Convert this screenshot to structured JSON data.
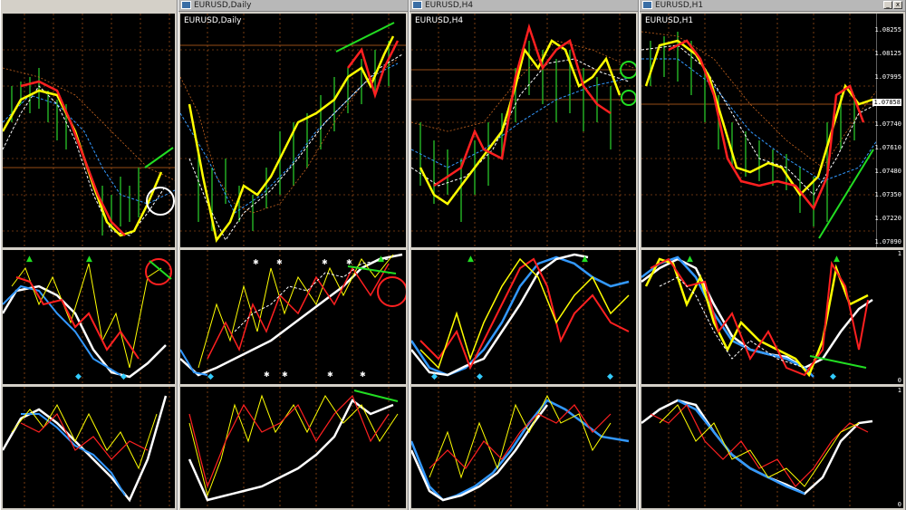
{
  "windows": [
    {
      "title": "",
      "symbol": ""
    },
    {
      "title": "EURUSD,Daily",
      "symbol": "EURUSD,Daily"
    },
    {
      "title": "EURUSD,H4",
      "symbol": "EURUSD,H4"
    },
    {
      "title": "EURUSD,H1",
      "symbol": "EURUSD,H1"
    }
  ],
  "h1_price_scale": [
    "1.08255",
    "1.08125",
    "1.07995",
    "1.07858",
    "1.07740",
    "1.07610",
    "1.07480",
    "1.07350",
    "1.07220",
    "1.07090"
  ],
  "h1_current_price": "1.07858",
  "indicator_scale": {
    "top": "1",
    "bottom": "0"
  },
  "colors": {
    "grid": "#c8641e",
    "up_candle": "#22aa22",
    "ma_fast": "#ffff00",
    "ma_slow": "#ff2020",
    "white": "#ffffff",
    "blue": "#3399ff",
    "annotation": "#22dd22"
  }
}
